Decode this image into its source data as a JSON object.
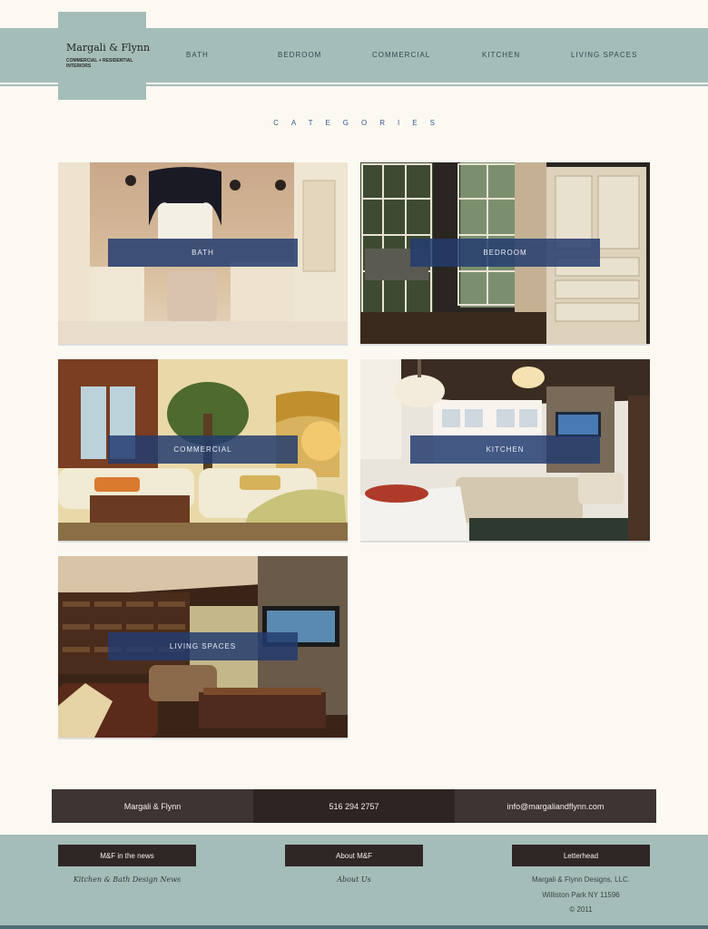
{
  "header": {
    "brand_name": "Margali & Flynn",
    "brand_tagline": "COMMERCIAL + RESIDENTIAL INTERIORS",
    "nav": [
      {
        "label": "BATH"
      },
      {
        "label": "BEDROOM"
      },
      {
        "label": "COMMERCIAL"
      },
      {
        "label": "KITCHEN"
      },
      {
        "label": "LIVING SPACES"
      }
    ]
  },
  "main": {
    "title": "CATEGORIES",
    "tiles": [
      {
        "label": "BATH"
      },
      {
        "label": "BEDROOM"
      },
      {
        "label": "COMMERCIAL"
      },
      {
        "label": "KITCHEN"
      },
      {
        "label": "LIVING SPACES"
      }
    ]
  },
  "contact": {
    "name": "Margali & Flynn",
    "phone": "516 294 2757",
    "email": "info@margaliandflynn.com"
  },
  "footer": {
    "news_heading": "M&F in the news",
    "news_link": "Kitchen & Bath Design News",
    "about_heading": "About M&F",
    "about_link": "About Us",
    "letterhead_heading": "Letterhead",
    "company": "Margali & Flynn Designs, LLC.",
    "address": "Williston Park NY 11596",
    "copyright": "© 2011"
  },
  "colors": {
    "header_teal": "#a5bdb8",
    "overlay_blue": "#233c6e",
    "contact_dark": "#3d3433",
    "background": "#fbf9f2"
  }
}
